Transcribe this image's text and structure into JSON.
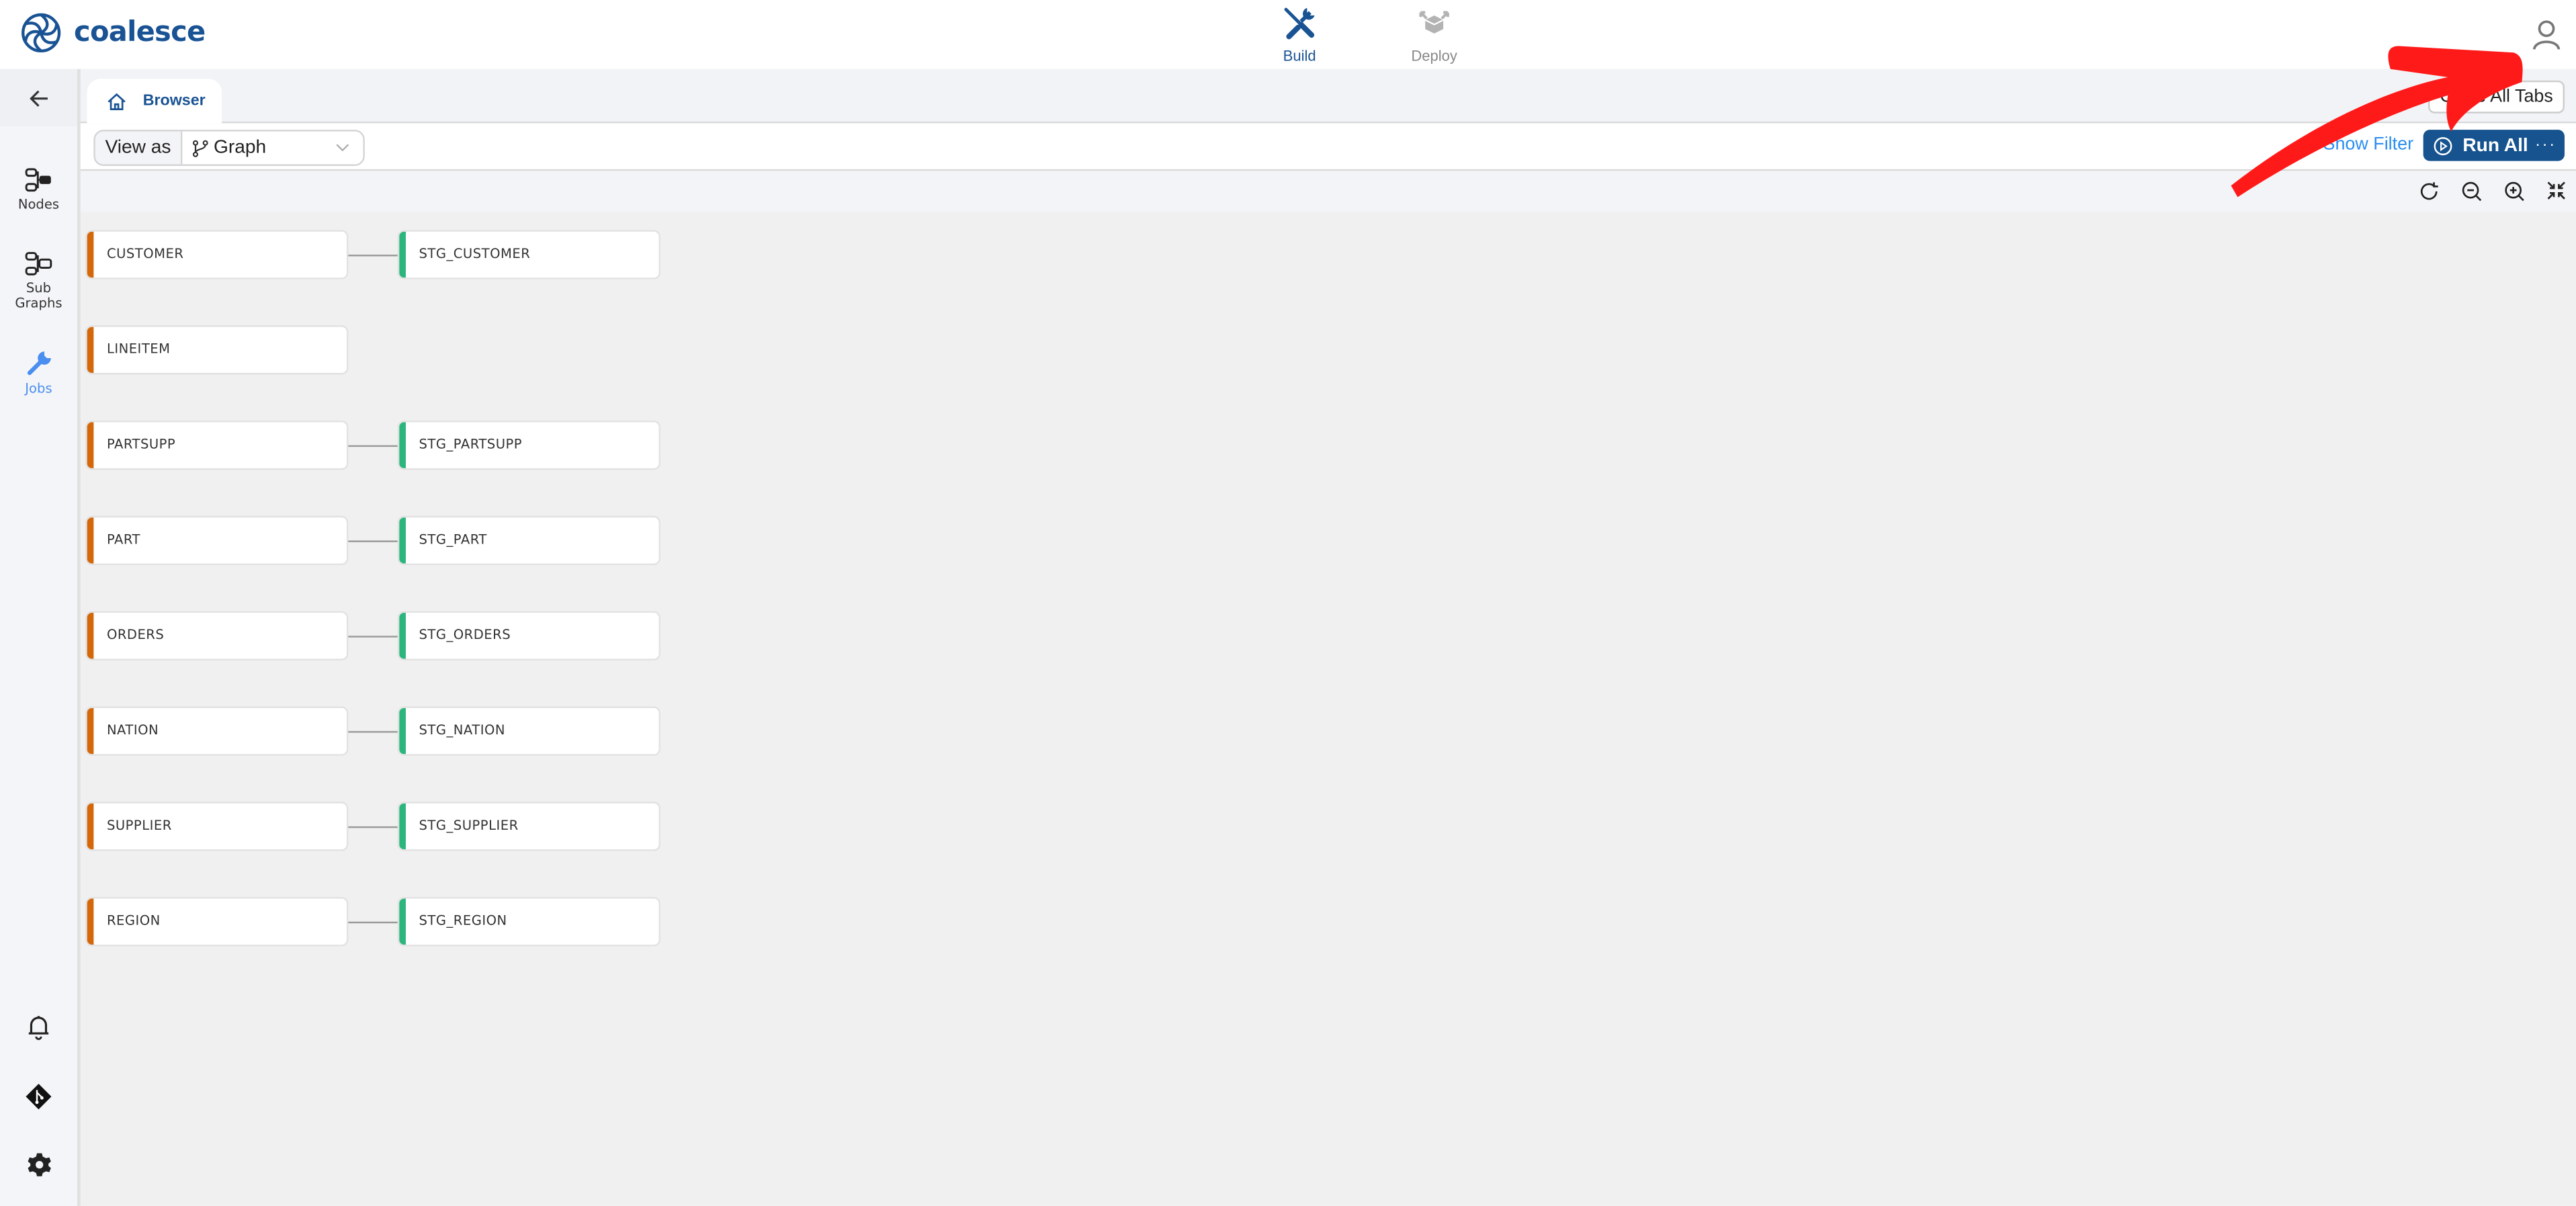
{
  "app": {
    "brand": "coalesce",
    "colors": {
      "brand": "#1a5394",
      "source_node": "#d4670a",
      "stage_node": "#2cb67d",
      "link": "#2a8ef0",
      "active_sidebar": "#4a8ff0",
      "annotation_arrow": "#ff1a1a"
    }
  },
  "topnav": {
    "items": [
      {
        "label": "Build",
        "icon": "build-tools-icon",
        "active": true
      },
      {
        "label": "Deploy",
        "icon": "deploy-box-icon",
        "active": false
      }
    ],
    "user_icon": "user-icon"
  },
  "sidebar": {
    "back_icon": "arrow-left-icon",
    "items": [
      {
        "label": "Nodes",
        "icon": "nodes-icon",
        "active": false
      },
      {
        "label": "Sub Graphs",
        "label_line1": "Sub",
        "label_line2": "Graphs",
        "icon": "subgraphs-icon",
        "active": false
      },
      {
        "label": "Jobs",
        "icon": "wrench-icon",
        "active": true
      }
    ],
    "bottom_icons": [
      "bell-icon",
      "git-icon",
      "gear-icon"
    ]
  },
  "tabs": {
    "items": [
      {
        "label": "Browser",
        "icon": "home-icon"
      }
    ],
    "close_all_label": "Close All Tabs"
  },
  "toolbar": {
    "view_as_label": "View as",
    "view_as_value": "Graph",
    "show_filter_label": "Show Filter",
    "run_all_label": "Run All",
    "more_label": "···"
  },
  "graph_tools": [
    "refresh-icon",
    "zoom-out-icon",
    "zoom-in-icon",
    "collapse-icon"
  ],
  "graph": {
    "rows": [
      {
        "source": "CUSTOMER",
        "stage": "STG_CUSTOMER"
      },
      {
        "source": "LINEITEM",
        "stage": null
      },
      {
        "source": "PARTSUPP",
        "stage": "STG_PARTSUPP"
      },
      {
        "source": "PART",
        "stage": "STG_PART"
      },
      {
        "source": "ORDERS",
        "stage": "STG_ORDERS"
      },
      {
        "source": "NATION",
        "stage": "STG_NATION"
      },
      {
        "source": "SUPPLIER",
        "stage": "STG_SUPPLIER"
      },
      {
        "source": "REGION",
        "stage": "STG_REGION"
      }
    ]
  }
}
